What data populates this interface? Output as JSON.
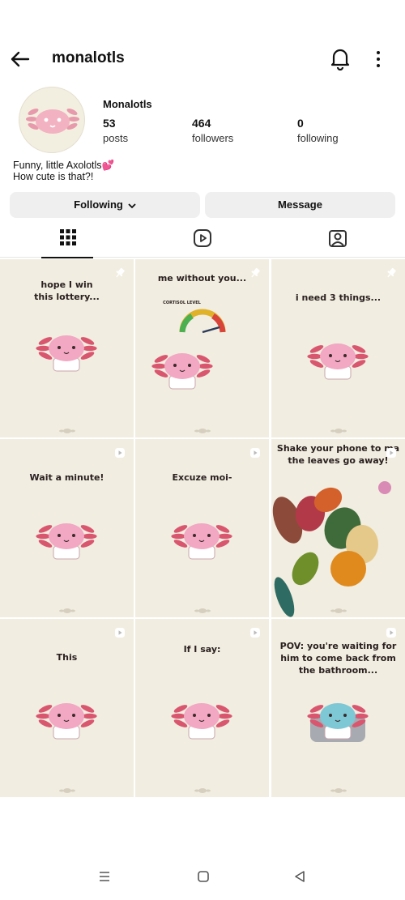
{
  "header": {
    "username": "monalotls"
  },
  "profile": {
    "display_name": "Monalotls",
    "posts_count": "53",
    "posts_label": "posts",
    "followers_count": "464",
    "followers_label": "followers",
    "following_count": "0",
    "following_label": "following",
    "bio_line1": "Funny, little Axolotls",
    "bio_line1_emoji": "💕",
    "bio_line2": "How cute is that?!"
  },
  "actions": {
    "following_label": "Following",
    "message_label": "Message"
  },
  "tabs": [
    {
      "icon": "grid-icon",
      "active": true
    },
    {
      "icon": "reels-icon",
      "active": false
    },
    {
      "icon": "tagged-icon",
      "active": false
    }
  ],
  "posts": [
    {
      "caption": "hope I win\nthis lottery...",
      "badge": "pin-icon"
    },
    {
      "caption": "me without you...",
      "sub": "CORTISOL LEVEL",
      "badge": "pin-icon"
    },
    {
      "caption": "i need 3 things...",
      "badge": "pin-icon"
    },
    {
      "caption": "Wait a minute!",
      "badge": "reel-icon"
    },
    {
      "caption": "Excuze moi-",
      "badge": "reel-icon"
    },
    {
      "caption": "Shake your phone to ma\nthe leaves go away!",
      "badge": "reel-icon"
    },
    {
      "caption": "This",
      "badge": "reel-icon"
    },
    {
      "caption": "If I say:",
      "badge": "reel-icon"
    },
    {
      "caption": "POV: you're waiting for\nhim to come back from\nthe bathroom...",
      "badge": "reel-icon"
    }
  ],
  "colors": {
    "axolotl_pink": "#f2a7c2",
    "axolotl_gill": "#d9566f",
    "tile_bg": "#f1ede0",
    "button_bg": "#efeff0"
  }
}
